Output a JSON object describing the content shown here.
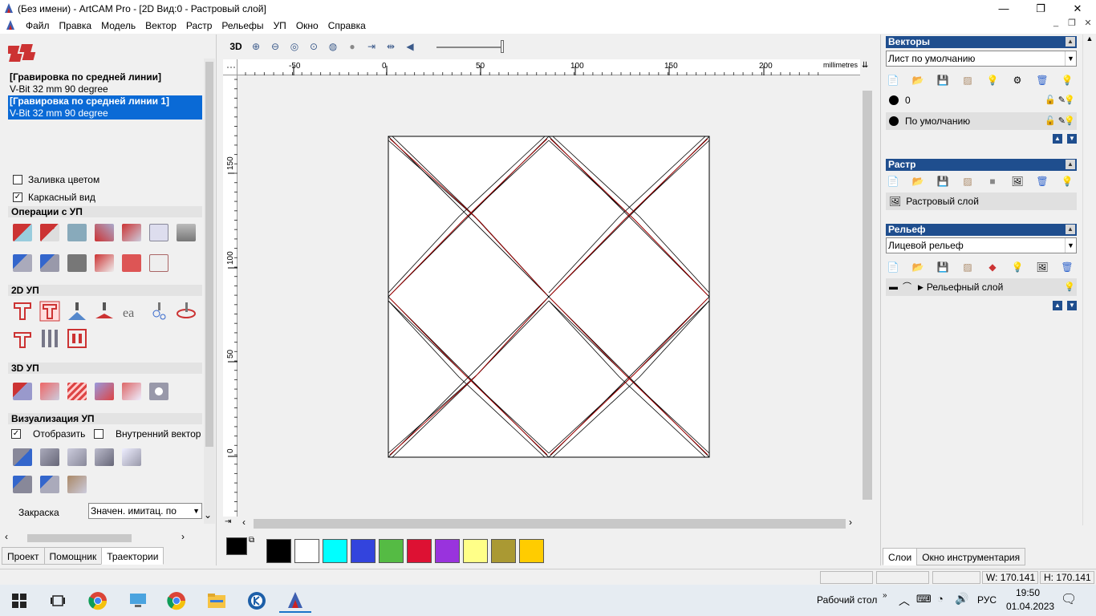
{
  "window": {
    "title": "(Без имени) - ArtCAM Pro - [2D Вид:0 - Растровый слой]",
    "minimize_glyph": "—",
    "maximize_glyph": "❐",
    "close_glyph": "✕"
  },
  "menu": {
    "items": [
      "Файл",
      "Правка",
      "Модель",
      "Вектор",
      "Растр",
      "Рельефы",
      "УП",
      "Окно",
      "Справка"
    ]
  },
  "left_panel": {
    "toolpaths": [
      {
        "name": "[Гравировка по средней линии]",
        "tool": "V-Bit 32 mm 90 degree",
        "selected": false
      },
      {
        "name": "[Гравировка по средней линии 1]",
        "tool": "V-Bit 32 mm 90 degree",
        "selected": true
      }
    ],
    "fill_color_label": "Заливка цветом",
    "fill_color_checked": false,
    "wireframe_label": "Каркасный вид",
    "wireframe_checked": true,
    "sections": {
      "ops": "Операции с УП",
      "2d": "2D УП",
      "3d": "3D УП",
      "viz": "Визуализация УП"
    },
    "show_label": "Отобразить",
    "show_checked": true,
    "inner_vector_label": "Внутренний вектор",
    "inner_vector_checked": false,
    "shading_label": "Закраска",
    "shading_value": "Значен. имитац. по",
    "tabs": [
      "Проект",
      "Помощник",
      "Траектории"
    ],
    "active_tab": "Траектории"
  },
  "view_toolbar": {
    "mode_3d": "3D"
  },
  "ruler": {
    "unit": "millimetres",
    "x_ticks": [
      "-50",
      "0",
      "50",
      "100",
      "150",
      "200"
    ],
    "y_ticks": [
      "150",
      "100",
      "50",
      "0"
    ]
  },
  "palette": {
    "colors": [
      "#000000",
      "#ffffff",
      "#00ffff",
      "#3344dd",
      "#55bb44",
      "#dd1133",
      "#9933dd",
      "#ffff88",
      "#aa9933",
      "#ffcc00"
    ]
  },
  "right_panel": {
    "vectors": {
      "title": "Векторы",
      "sheet": "Лист по умолчанию",
      "layers": [
        "0",
        "По умолчанию"
      ]
    },
    "raster": {
      "title": "Растр",
      "layer": "Растровый слой"
    },
    "relief": {
      "title": "Рельеф",
      "face": "Лицевой рельеф",
      "layer": "Рельефный слой"
    },
    "tabs": [
      "Слои",
      "Окно инструментария"
    ],
    "active_tab": "Слои"
  },
  "status": {
    "width": "W: 170.141",
    "height": "H: 170.141"
  },
  "taskbar": {
    "desktop_label": "Рабочий стол",
    "language": "РУС",
    "time": "19:50",
    "date": "01.04.2023"
  }
}
